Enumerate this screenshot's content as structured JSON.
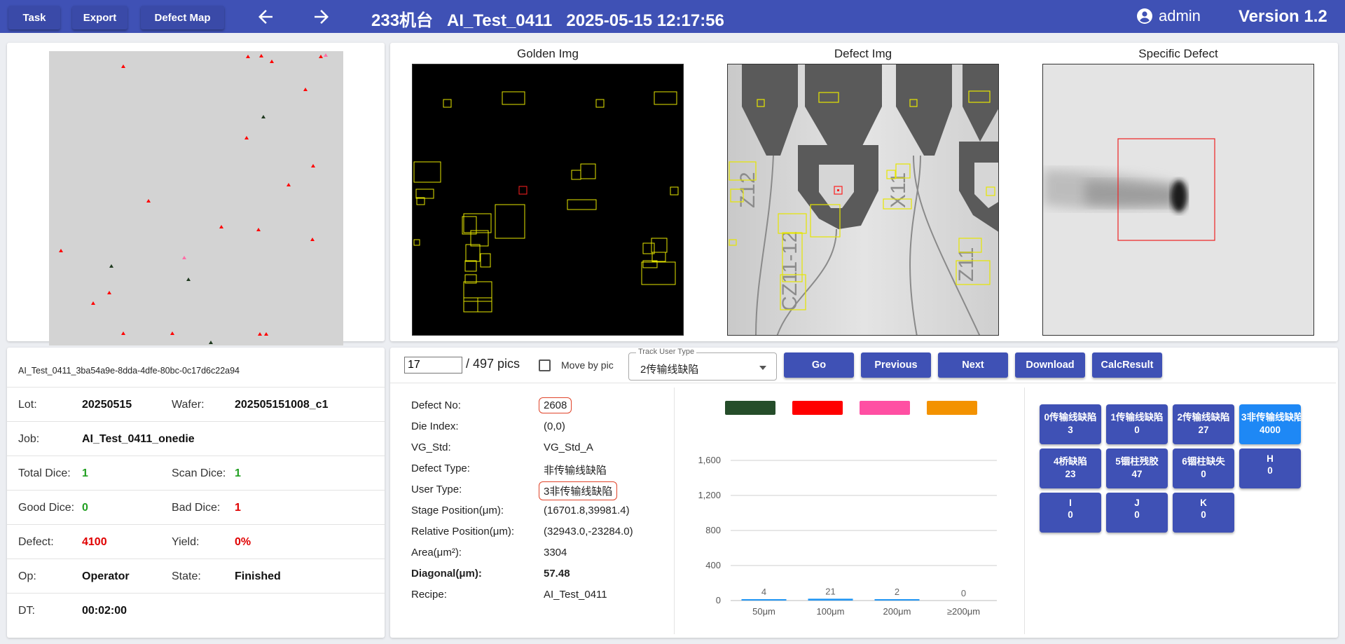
{
  "header": {
    "task_label": "Task",
    "export_label": "Export",
    "defect_map_label": "Defect Map",
    "title": "233机台   AI_Test_0411   2025-05-15 12:17:56",
    "user": "admin",
    "version": "Version 1.2"
  },
  "images": {
    "golden_title": "Golden Img",
    "defect_title": "Defect Img",
    "specific_title": "Specific Defect",
    "pad_labels": [
      "Z12",
      "X11",
      "CZ11-12",
      "Z11"
    ]
  },
  "info": {
    "id": "AI_Test_0411_3ba54a9e-8dda-4dfe-80bc-0c17d6c22a94",
    "lot_label": "Lot:",
    "lot": "20250515",
    "wafer_label": "Wafer:",
    "wafer": "202505151008_c1",
    "job_label": "Job:",
    "job": "AI_Test_0411_onedie",
    "total_dice_label": "Total Dice:",
    "total_dice": "1",
    "scan_dice_label": "Scan Dice:",
    "scan_dice": "1",
    "good_dice_label": "Good Dice:",
    "good_dice": "0",
    "bad_dice_label": "Bad Dice:",
    "bad_dice": "1",
    "defect_label": "Defect:",
    "defect": "4100",
    "yield_label": "Yield:",
    "yield": "0%",
    "op_label": "Op:",
    "op": "Operator",
    "state_label": "State:",
    "state": "Finished",
    "dt_label": "DT:",
    "dt": "00:02:00"
  },
  "controls": {
    "pic_value": "17",
    "pic_total": "/ 497 pics",
    "move_by_pic": "Move by pic",
    "track_legend": "Track User Type",
    "track_value": "2传输线缺陷",
    "go": "Go",
    "previous": "Previous",
    "next": "Next",
    "download": "Download",
    "calc": "CalcResult"
  },
  "defect": {
    "rows": [
      {
        "label": "Defect No:",
        "value": "2608"
      },
      {
        "label": "Die Index:",
        "value": "(0,0)"
      },
      {
        "label": "VG_Std:",
        "value": "VG_Std_A"
      },
      {
        "label": "Defect Type:",
        "value": "非传输线缺陷"
      },
      {
        "label": "User Type:",
        "value": "3非传输线缺陷"
      },
      {
        "label": "Stage Position(μm):",
        "value": "(16701.8,39981.4)"
      },
      {
        "label": "Relative Position(μm):",
        "value": "(32943.0,-23284.0)"
      },
      {
        "label": "Area(μm²):",
        "value": "3304"
      },
      {
        "label": "Diagonal(μm):",
        "value": "57.48"
      },
      {
        "label": "Recipe:",
        "value": "AI_Test_0411"
      }
    ]
  },
  "chart_data": {
    "type": "bar",
    "categories": [
      "50μm",
      "100μm",
      "200μm",
      "≥200μm"
    ],
    "values": [
      4,
      21,
      2,
      0
    ],
    "yticks": [
      "0",
      "400",
      "800",
      "1,200",
      "1,600"
    ],
    "ylim": [
      0,
      1600
    ],
    "legend_colors": [
      "#254d2a",
      "#ff0000",
      "#ff4fa3",
      "#f39200"
    ],
    "bar_color": "#2196f3",
    "legend_position": "top"
  },
  "counters": [
    {
      "name": "0传输线缺陷",
      "count": "3"
    },
    {
      "name": "1传输线缺陷",
      "count": "0"
    },
    {
      "name": "2传输线缺陷",
      "count": "27"
    },
    {
      "name": "3非传输线缺陷",
      "count": "4000"
    },
    {
      "name": "4桥缺陷",
      "count": "23"
    },
    {
      "name": "5锢柱残胶",
      "count": "47"
    },
    {
      "name": "6锢柱缺失",
      "count": "0"
    },
    {
      "name": "H",
      "count": "0"
    },
    {
      "name": "I",
      "count": "0"
    },
    {
      "name": "J",
      "count": "0"
    },
    {
      "name": "K",
      "count": "0"
    }
  ],
  "colors": {
    "header": "#3f51b5",
    "active_counter": "#1e88f5",
    "box": "#e6e600",
    "marker": "#ff0000"
  }
}
